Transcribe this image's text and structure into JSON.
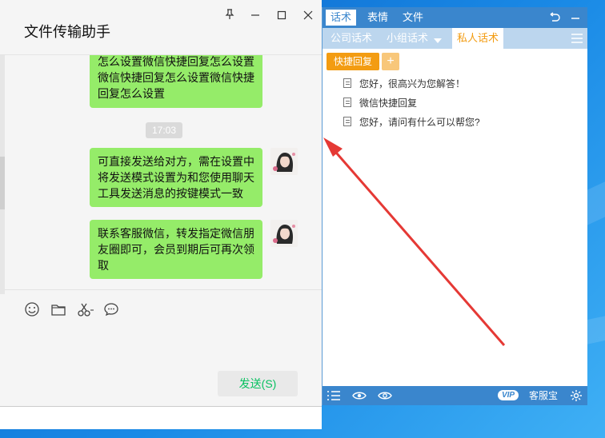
{
  "wechat": {
    "title": "文件传输助手",
    "window_controls": [
      "pin",
      "minimize",
      "maximize",
      "close"
    ],
    "messages": [
      {
        "type": "sent",
        "text": "怎么设置微信快捷回复怎么设置微信快捷回复怎么设置微信快捷回复怎么设置"
      },
      {
        "type": "time",
        "text": "17:03"
      },
      {
        "type": "sent",
        "text": "可直接发送给对方，需在设置中将发送模式设置为和您使用聊天工具发送消息的按键模式一致"
      },
      {
        "type": "sent",
        "text": "联系客服微信，转发指定微信朋友圈即可，会员到期后可再次领取"
      }
    ],
    "toolbar_icons": [
      "emoji-icon",
      "folder-icon",
      "scissors-icon",
      "chat-history-icon"
    ],
    "send_label": "发送(S)",
    "bubble_color": "#95ec69"
  },
  "panel": {
    "top_tabs": [
      "话术",
      "表情",
      "文件"
    ],
    "sub_tabs": [
      "公司话术",
      "小组话术",
      "私人话术"
    ],
    "active_sub_tab": "私人话术",
    "quick_reply_label": "快捷回复",
    "add_label": "+",
    "replies": [
      "您好，很高兴为您解答！",
      "微信快捷回复",
      "您好，请问有什么可以帮您?"
    ],
    "bottom": {
      "vip": "VIP",
      "brand": "客服宝"
    },
    "accent": "#3a86cd",
    "orange": "#f39c12"
  }
}
